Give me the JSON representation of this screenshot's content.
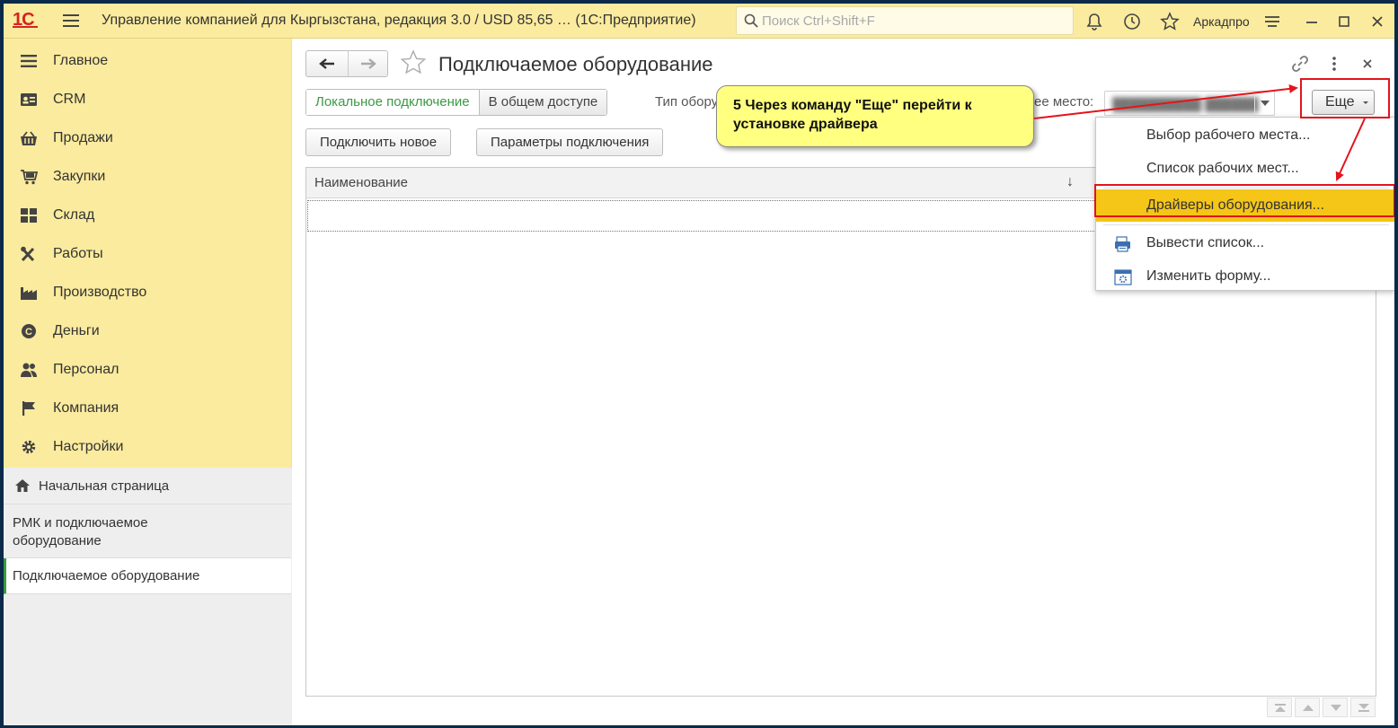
{
  "titlebar": {
    "logo": "1С",
    "app_title": "Управление компанией для Кыргызстана, редакция 3.0 / USD 85,65 …  (1С:Предприятие)",
    "search_placeholder": "Поиск Ctrl+Shift+F",
    "username": "Аркадпро",
    "icons": [
      "bell-icon",
      "history-icon",
      "star-icon",
      "menu-icon",
      "minimize-icon",
      "maximize-icon",
      "close-icon"
    ]
  },
  "sidebar": {
    "sections": [
      {
        "label": "Главное",
        "icon": "menu-icon"
      },
      {
        "label": "CRM",
        "icon": "contact-card-icon"
      },
      {
        "label": "Продажи",
        "icon": "basket-icon"
      },
      {
        "label": "Закупки",
        "icon": "cart-icon"
      },
      {
        "label": "Склад",
        "icon": "warehouse-icon"
      },
      {
        "label": "Работы",
        "icon": "tools-icon"
      },
      {
        "label": "Производство",
        "icon": "factory-icon"
      },
      {
        "label": "Деньги",
        "icon": "money-icon"
      },
      {
        "label": "Персонал",
        "icon": "people-icon"
      },
      {
        "label": "Компания",
        "icon": "flag-icon"
      },
      {
        "label": "Настройки",
        "icon": "gear-icon"
      }
    ],
    "nav": [
      {
        "label": "Начальная страница"
      },
      {
        "label": "РМК и подключаемое оборудование"
      },
      {
        "label": "Подключаемое оборудование"
      }
    ]
  },
  "form": {
    "title": "Подключаемое оборудование",
    "tabs": [
      "Локальное подключение",
      "В общем доступе"
    ],
    "type_label": "Тип оборудования:",
    "workstation_label": "ее место:",
    "workstation_value": "██████████ ██████",
    "more_button": "Еще",
    "buttons": {
      "connect_new": "Подключить новое",
      "connection_params": "Параметры подключения"
    },
    "table": {
      "column": "Наименование",
      "sort_indicator": "↓"
    }
  },
  "menu": {
    "items": [
      {
        "label": "Выбор рабочего места...",
        "icon": ""
      },
      {
        "label": "Список рабочих мест...",
        "icon": ""
      },
      {
        "label": "Драйверы оборудования...",
        "icon": "",
        "highlighted": true
      },
      {
        "label": "Вывести список...",
        "icon": "print-list-icon"
      },
      {
        "label": "Изменить форму...",
        "icon": "form-settings-icon"
      }
    ]
  },
  "annotation": {
    "text": "5 Через команду \"Еще\" перейти к установке драйвера",
    "color": "#ffff80",
    "highlight_color": "#e3141b"
  },
  "colors": {
    "accent_yellow": "#fbeb9e",
    "active_green": "#3a9a44",
    "menu_highlight": "#f5c518"
  }
}
